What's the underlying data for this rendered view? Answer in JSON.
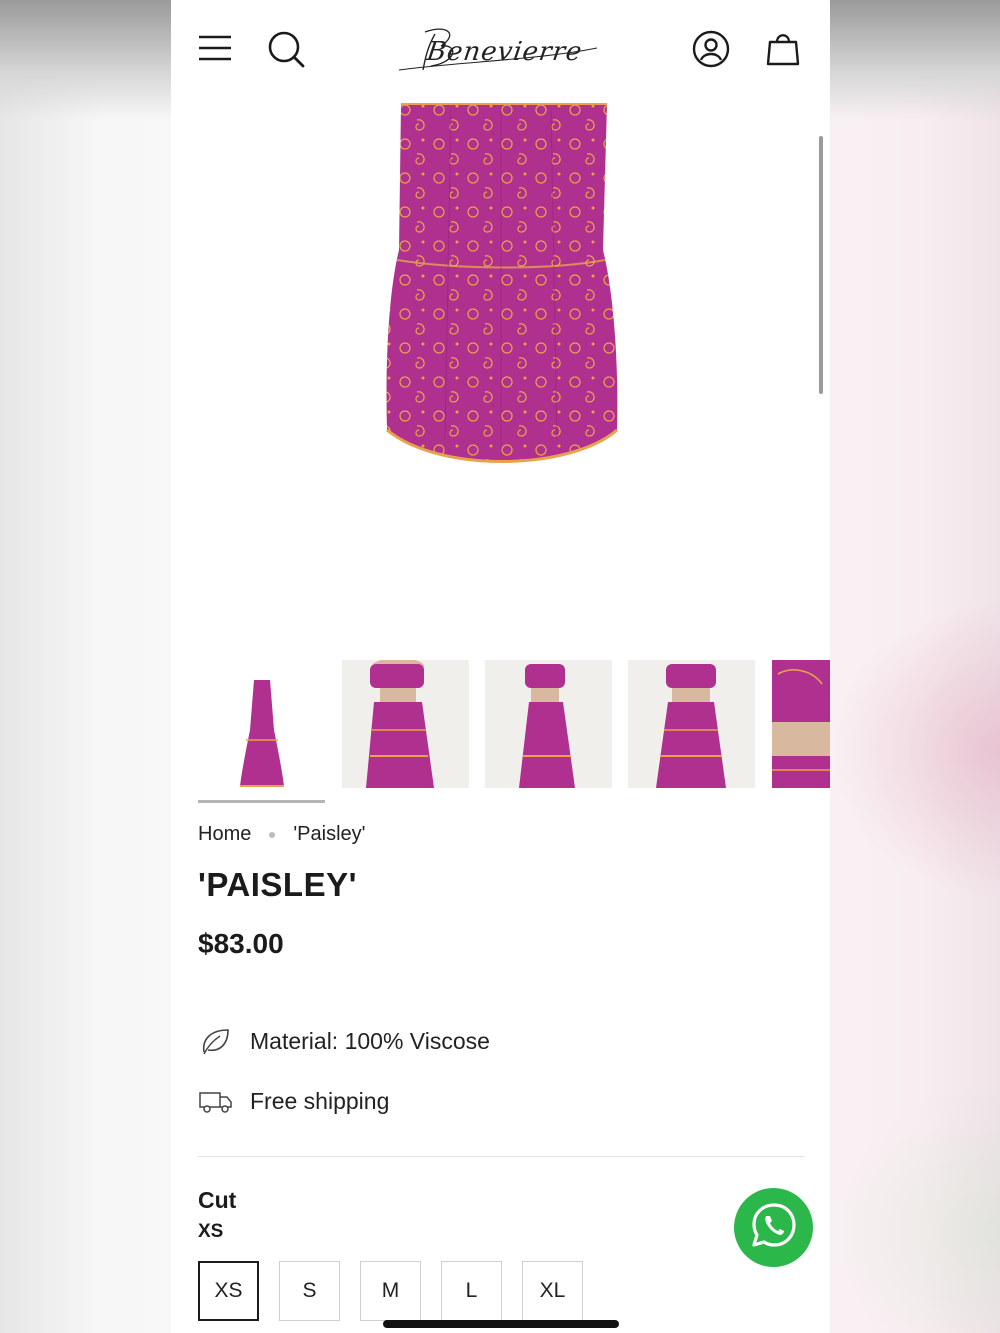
{
  "header": {
    "brand": "Benevierre",
    "menu_icon": "hamburger-menu-icon",
    "search_icon": "search-icon",
    "account_icon": "user-account-icon",
    "cart_icon": "shopping-bag-icon"
  },
  "breadcrumb": {
    "home": "Home",
    "current": "'Paisley'"
  },
  "product": {
    "title": "'PAISLEY'",
    "price": "$83.00",
    "features": [
      {
        "icon": "leaf-icon",
        "text": "Material: 100% Viscose"
      },
      {
        "icon": "delivery-truck-icon",
        "text": "Free shipping"
      }
    ],
    "thumbnails_count": 5,
    "selected_thumbnail": 1,
    "colors": {
      "fabric": "#b0308f",
      "pattern": "#e8a34a"
    }
  },
  "options": {
    "cut_label": "Cut",
    "selected_size": "XS",
    "sizes": [
      "XS",
      "S",
      "M",
      "L",
      "XL"
    ]
  },
  "floating": {
    "whatsapp_icon": "whatsapp-icon",
    "accent": "#2bb74a"
  }
}
